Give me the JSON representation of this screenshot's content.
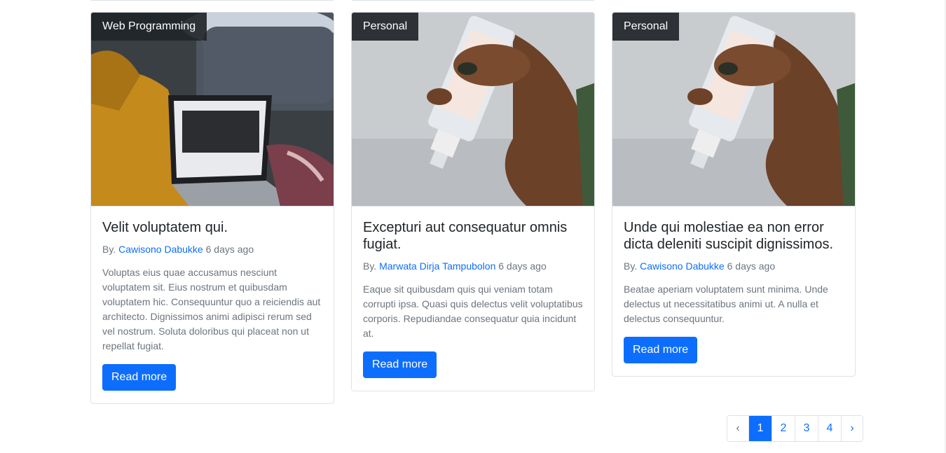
{
  "posts": [
    {
      "category": "Web Programming",
      "title": "Velit voluptatem qui.",
      "by_label": "By.",
      "author": "Cawisono Dabukke",
      "time": "6 days ago",
      "excerpt": "Voluptas eius quae accusamus nesciunt voluptatem sit. Eius nostrum et quibusdam voluptatem hic. Consequuntur quo a reiciendis aut architecto. Dignissimos animi adipisci rerum sed vel nostrum. Soluta doloribus qui placeat non ut repellat fugiat.",
      "button": "Read more"
    },
    {
      "category": "Personal",
      "title": "Excepturi aut consequatur omnis fugiat.",
      "by_label": "By.",
      "author": "Marwata Dirja Tampubolon",
      "time": "6 days ago",
      "excerpt": "Eaque sit quibusdam quis qui veniam totam corrupti ipsa. Quasi quis delectus velit voluptatibus corporis. Repudiandae consequatur quia incidunt at.",
      "button": "Read more"
    },
    {
      "category": "Personal",
      "title": "Unde qui molestiae ea non error dicta deleniti suscipit dignissimos.",
      "by_label": "By.",
      "author": "Cawisono Dabukke",
      "time": "6 days ago",
      "excerpt": "Beatae aperiam voluptatem sunt minima. Unde delectus ut necessitatibus animi ut. A nulla et delectus consequuntur.",
      "button": "Read more"
    }
  ],
  "pagination": {
    "prev": "‹",
    "pages": [
      "1",
      "2",
      "3",
      "4"
    ],
    "current": "1",
    "next": "›"
  },
  "colors": {
    "primary": "#0d6efd",
    "badge_bg": "#212529",
    "muted": "#6c757d"
  }
}
